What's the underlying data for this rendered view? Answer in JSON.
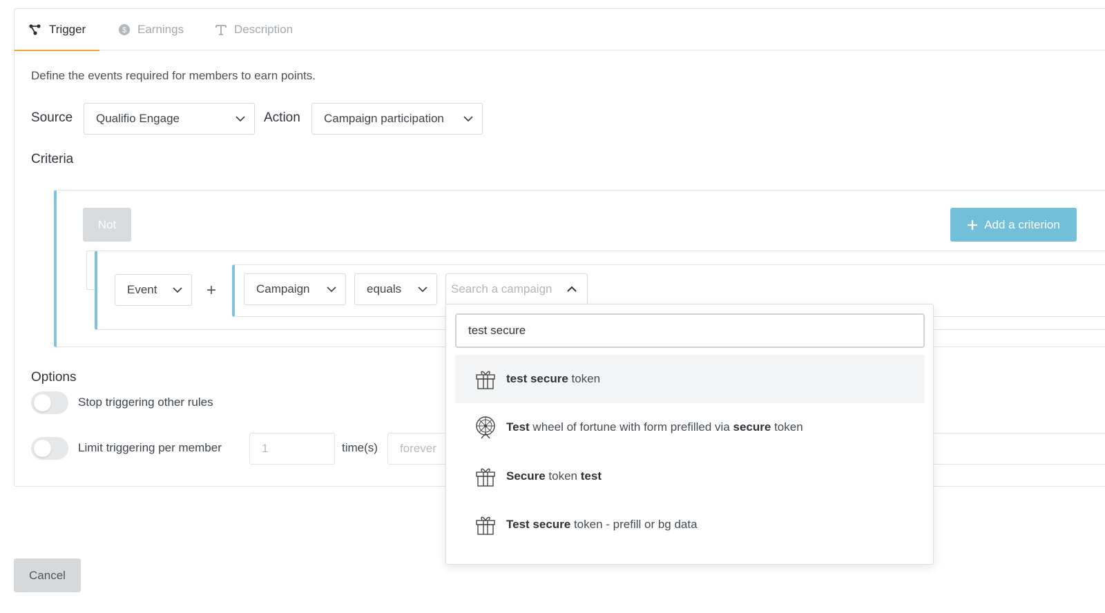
{
  "tabs": [
    {
      "label": "Trigger",
      "icon": "trigger-icon",
      "active": true
    },
    {
      "label": "Earnings",
      "icon": "coin-icon",
      "active": false
    },
    {
      "label": "Description",
      "icon": "text-icon",
      "active": false
    }
  ],
  "description": "Define the events required for members to earn points.",
  "source": {
    "label": "Source",
    "value": "Qualifio Engage"
  },
  "action": {
    "label": "Action",
    "value": "Campaign participation"
  },
  "criteria": {
    "label": "Criteria",
    "not_label": "Not",
    "add_label": "Add a criterion",
    "event_value": "Event",
    "plus": "+",
    "campaign_value": "Campaign",
    "operator_value": "equals",
    "search_placeholder": "Search a campaign"
  },
  "options": {
    "title": "Options",
    "stop_label": "Stop triggering other rules",
    "limit_label": "Limit triggering per member",
    "limit_value": "1",
    "times_label": "time(s)",
    "period_value": "forever"
  },
  "cancel_label": "Cancel",
  "dropdown": {
    "query": "test secure",
    "results": [
      {
        "icon": "gift-icon",
        "parts": [
          {
            "t": "test secure",
            "b": true
          },
          {
            "t": " token",
            "b": false
          }
        ]
      },
      {
        "icon": "wheel-icon",
        "parts": [
          {
            "t": "Test",
            "b": true
          },
          {
            "t": " wheel of fortune with form prefilled via ",
            "b": false
          },
          {
            "t": "secure",
            "b": true
          },
          {
            "t": " token",
            "b": false
          }
        ]
      },
      {
        "icon": "gift-icon",
        "parts": [
          {
            "t": "Secure",
            "b": true
          },
          {
            "t": " token ",
            "b": false
          },
          {
            "t": "test",
            "b": true
          }
        ]
      },
      {
        "icon": "gift-icon",
        "parts": [
          {
            "t": "Test secure",
            "b": true
          },
          {
            "t": " token - prefill or bg data",
            "b": false
          }
        ]
      }
    ]
  },
  "colors": {
    "accent": "#f0a531",
    "criteria_border": "#7ec3db",
    "add_button": "#72bfd9"
  }
}
